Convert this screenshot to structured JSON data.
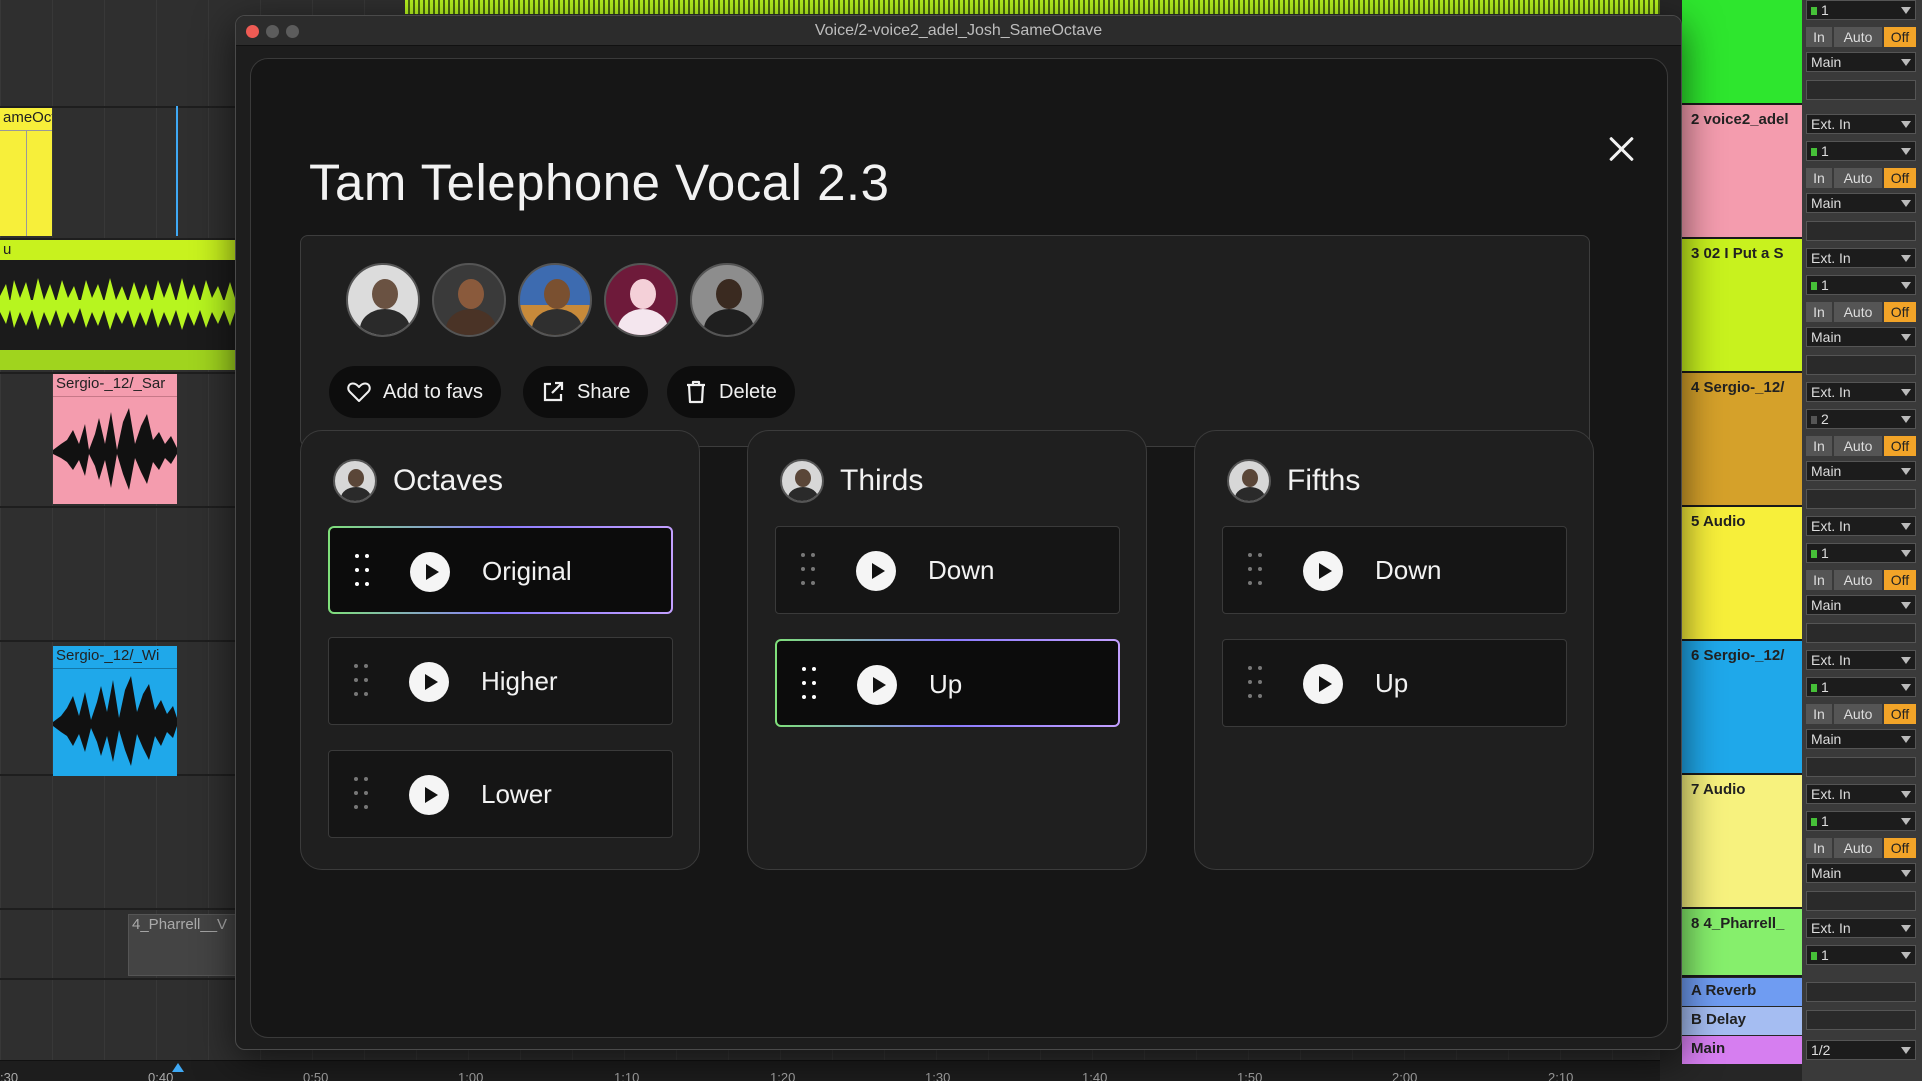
{
  "window": {
    "title": "Voice/2-voice2_adel_Josh_SameOctave"
  },
  "modal": {
    "preset_title": "Tam Telephone Vocal 2.3",
    "actions": {
      "favs_label": "Add to favs",
      "share_label": "Share",
      "delete_label": "Delete"
    },
    "avatar_count": 5,
    "groups": [
      {
        "title": "Octaves",
        "items": [
          "Original",
          "Higher",
          "Lower"
        ],
        "selected": "Original"
      },
      {
        "title": "Thirds",
        "items": [
          "Down",
          "Up"
        ],
        "selected": "Up"
      },
      {
        "title": "Fifths",
        "items": [
          "Down",
          "Up"
        ],
        "selected": null
      }
    ]
  },
  "daw": {
    "clips": {
      "clip1": "ameOct",
      "clip2": "u",
      "clip3": "Sergio-_12/_Sar",
      "clip4": "Sergio-_12/_Wi",
      "clip5": "4_Pharrell__V"
    },
    "ruler": [
      ":30",
      "0:40",
      "0:50",
      "1:00",
      "1:10",
      "1:20",
      "1:30",
      "1:40",
      "1:50",
      "2:00",
      "2:10"
    ],
    "tracks": [
      {
        "name": "",
        "color": "#2ee62e"
      },
      {
        "name": "2 voice2_adel",
        "color": "#f49cae"
      },
      {
        "name": "3 02 I Put a S",
        "color": "#c8f21e"
      },
      {
        "name": "4 Sergio-_12/",
        "color": "#d5a12a"
      },
      {
        "name": "5 Audio",
        "color": "#f7ef3a"
      },
      {
        "name": "6 Sergio-_12/",
        "color": "#1fa8ea"
      },
      {
        "name": "7 Audio",
        "color": "#f7f27e"
      },
      {
        "name": "8 4_Pharrell_",
        "color": "#86ef6c"
      }
    ],
    "returns": [
      {
        "name": "A Reverb",
        "color": "#6f9cf2"
      },
      {
        "name": "B Delay",
        "color": "#a5bdf2"
      },
      {
        "name": "Main",
        "color": "#d67ef0"
      }
    ],
    "io": {
      "ext_in": "Ext. In",
      "in_label": "In",
      "auto_label": "Auto",
      "off_label": "Off",
      "main_label": "Main",
      "channel_values": [
        "1",
        "1",
        "1",
        "2",
        "1",
        "1",
        "1",
        "1"
      ],
      "master_route": "1/2"
    }
  }
}
